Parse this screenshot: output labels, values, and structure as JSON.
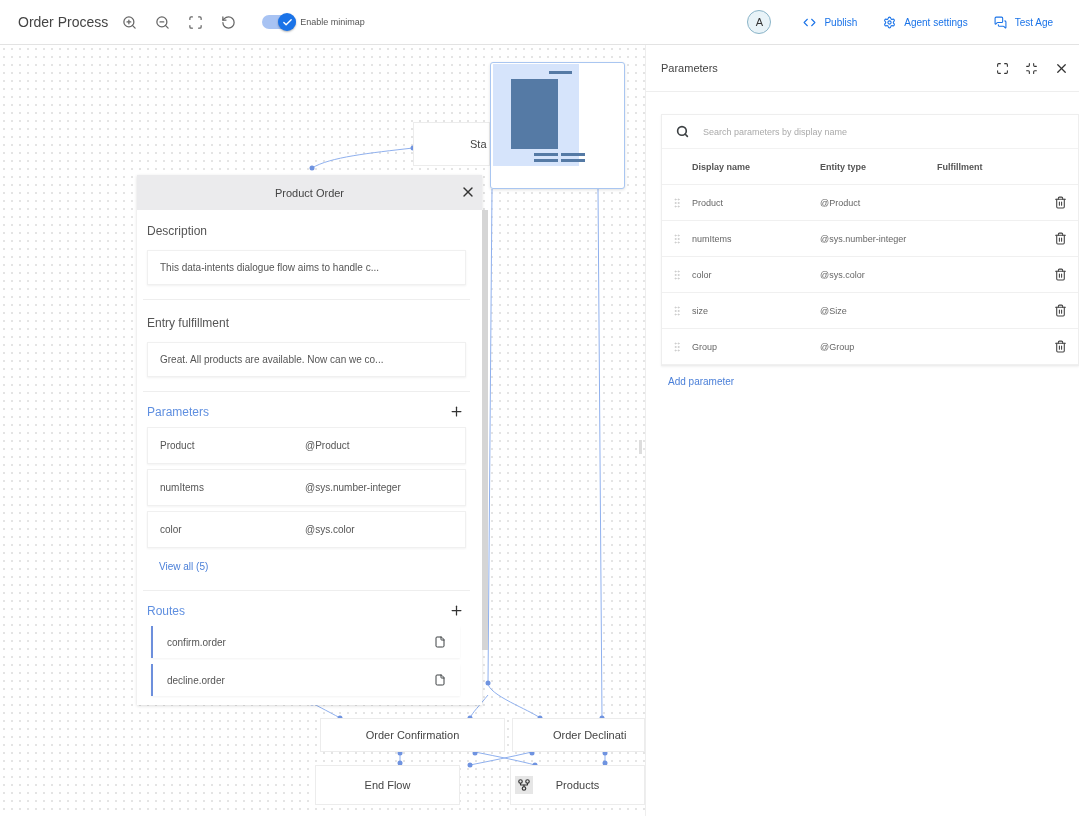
{
  "toolbar": {
    "title": "Order Process",
    "minimap_toggle": {
      "label": "Enable minimap",
      "on": true
    },
    "avatar": "A",
    "actions": [
      {
        "label": "Publish"
      },
      {
        "label": "Agent settings"
      },
      {
        "label": "Test Age"
      }
    ]
  },
  "canvas": {
    "nodes": [
      {
        "label": "Sta"
      },
      {
        "label": "Order Confirmation"
      },
      {
        "label": "Order Declinati"
      },
      {
        "label": "End Flow"
      },
      {
        "label": "Products"
      }
    ],
    "page_card": {
      "title": "Product Order",
      "description_label": "Description",
      "description": "This data-intents dialogue flow aims to handle c...",
      "fulfillment_label": "Entry fulfillment",
      "fulfillment": "Great. All products are available. Now can we co...",
      "parameters": {
        "title": "Parameters",
        "items": [
          {
            "name": "Product",
            "type": "@Product"
          },
          {
            "name": "numItems",
            "type": "@sys.number-integer"
          },
          {
            "name": "color",
            "type": "@sys.color"
          }
        ],
        "view_all": "View all (5)"
      },
      "routes": {
        "title": "Routes",
        "items": [
          "confirm.order",
          "decline.order"
        ]
      }
    }
  },
  "parameters_panel": {
    "title": "Parameters",
    "search": {
      "placeholder": "Search parameters by display name"
    },
    "columns": [
      "Display name",
      "Entity type",
      "Fulfillment"
    ],
    "rows": [
      {
        "name": "Product",
        "type": "@Product"
      },
      {
        "name": "numItems",
        "type": "@sys.number-integer"
      },
      {
        "name": "color",
        "type": "@sys.color"
      },
      {
        "name": "size",
        "type": "@Size"
      },
      {
        "name": "Group",
        "type": "@Group"
      }
    ],
    "add": "Add parameter"
  }
}
